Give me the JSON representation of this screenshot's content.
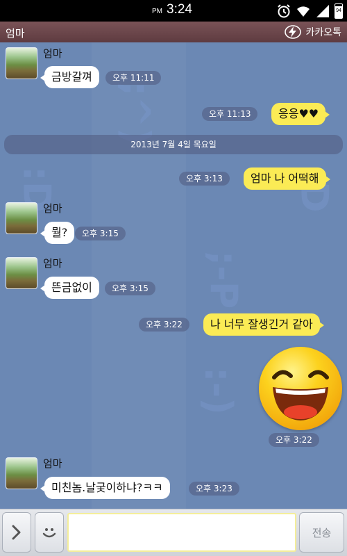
{
  "status_bar": {
    "ampm": "PM",
    "time": "3:24",
    "battery": "94"
  },
  "header": {
    "title": "엄마",
    "brand": "카카오톡"
  },
  "date_divider": "2013년 7월 4일 목요일",
  "messages": [
    {
      "sender": "엄마",
      "text": "금방갈껴",
      "time": "오후 11:11"
    },
    {
      "text": "응응♥♥",
      "time": "오후 11:13"
    },
    {
      "text": "엄마 나 어떡해",
      "time": "오후 3:13"
    },
    {
      "sender": "엄마",
      "text": "뭘?",
      "time": "오후 3:15"
    },
    {
      "sender": "엄마",
      "text": "뜬금없이",
      "time": "오후 3:15"
    },
    {
      "text": "나 너무 잘생긴거 같아",
      "time": "오후 3:22"
    },
    {
      "text": "",
      "time": "오후 3:22"
    },
    {
      "sender": "엄마",
      "text": "미친놈.날궂이하냐?ㅋㅋ",
      "time": "오후 3:23"
    }
  ],
  "input_bar": {
    "message_value": "",
    "send_label": "전송"
  },
  "background_emoticons": [
    ";^)",
    ":D",
    ";D",
    ";-P",
    ":-)"
  ],
  "colors": {
    "chat_bg": "#6b88b4",
    "my_bubble": "#fbeb55",
    "other_bubble": "#ffffff",
    "title_bar": "#6a474b"
  }
}
